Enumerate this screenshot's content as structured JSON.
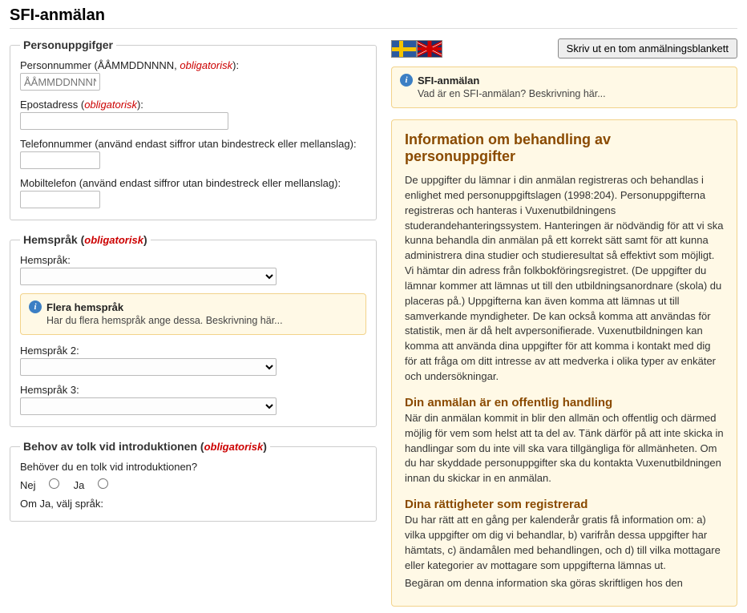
{
  "page": {
    "title": "SFI-anmälan"
  },
  "obligatorisk": "obligatorisk",
  "personal": {
    "legend": "Personuppgifger",
    "pnr_label_pre": "Personnummer (ÅÅMMDDNNNN, ",
    "pnr_label_post": "):",
    "pnr_placeholder": "ÅÅMMDDNNNN",
    "email_label_pre": "Epostadress (",
    "email_label_post": "):",
    "phone_label": "Telefonnummer (använd endast siffror utan bindestreck eller mellanslag):",
    "mobile_label": "Mobiltelefon (använd endast siffror utan bindestreck eller mellanslag):"
  },
  "lang": {
    "legend_pre": "Hemspråk (",
    "legend_post": ")",
    "l1": "Hemspråk:",
    "l2": "Hemspråk 2:",
    "l3": "Hemspråk 3:",
    "info_title": "Flera hemspråk",
    "info_desc": "Har du flera hemspråk ange dessa. Beskrivning här..."
  },
  "interpreter": {
    "legend_pre": "Behov av tolk vid introduktionen (",
    "legend_post": ")",
    "q": "Behöver du en tolk vid introduktionen?",
    "no": "Nej",
    "yes": "Ja",
    "if_yes": "Om Ja, välj språk:"
  },
  "top": {
    "print_btn": "Skriv ut en tom anmälningsblankett",
    "intro_title": "SFI-anmälan",
    "intro_desc": "Vad är en SFI-anmälan? Beskrivning här..."
  },
  "gdpr": {
    "h2": "Information om behandling av personuppgifter",
    "p1": "De uppgifter du lämnar i din anmälan registreras och behandlas i enlighet med personuppgiftslagen (1998:204). Personuppgifterna registreras och hanteras i Vuxenutbildningens studerandehanteringssystem. Hanteringen är nödvändig för att vi ska kunna behandla din anmälan på ett korrekt sätt samt för att kunna administrera dina studier och studieresultat så effektivt som möjligt. Vi hämtar din adress från folkbokföringsregistret. (De uppgifter du lämnar kommer att lämnas ut till den utbildningsanordnare (skola) du placeras på.) Uppgifterna kan även komma att lämnas ut till samverkande myndigheter. De kan också komma att användas för statistik, men är då helt avpersonifierade. Vuxenutbildningen kan komma att använda dina uppgifter för att komma i kontakt med dig för att fråga om ditt intresse av att medverka i olika typer av enkäter och undersökningar.",
    "h3a": "Din anmälan är en offentlig handling",
    "p2": "När din anmälan kommit in blir den allmän och offentlig och därmed möjlig för vem som helst att ta del av. Tänk därför på att inte skicka in handlingar som du inte vill ska vara tillgängliga för allmänheten. Om du har skyddade personuppgifter ska du kontakta Vuxenutbildningen innan du skickar in en anmälan.",
    "h3b": "Dina rättigheter som registrerad",
    "p3": "Du har rätt att en gång per kalenderår gratis få information om: a) vilka uppgifter om dig vi behandlar, b) varifrån dessa uppgifter har hämtats, c) ändamålen med behandlingen, och d) till vilka mottagare eller kategorier av mottagare som uppgifterna lämnas ut.",
    "p4": "Begäran om denna information ska göras skriftligen hos den"
  }
}
